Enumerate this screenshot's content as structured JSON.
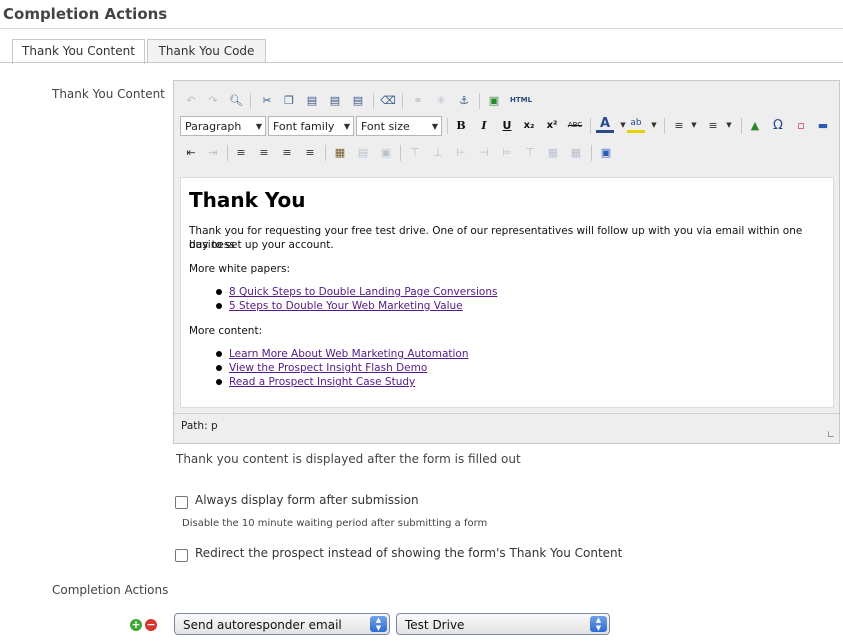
{
  "section_title": "Completion Actions",
  "tabs": [
    {
      "label": "Thank You Content",
      "active": true
    },
    {
      "label": "Thank You Code",
      "active": false
    }
  ],
  "thank_you_label": "Thank You Content",
  "editor": {
    "format_select": "Paragraph",
    "font_family_select": "Font family",
    "font_size_select": "Font size",
    "html_button": "HTML",
    "content": {
      "heading": "Thank You",
      "paragraph1_line1": "Thank you for requesting your free test drive. One of our representatives will follow up with you via email within one business",
      "paragraph1_line2": "day to set up your account.",
      "white_papers_label": "More white papers:",
      "white_papers": [
        "8 Quick Steps to Double Landing Page Conversions",
        "5 Steps to Double Your Web Marketing Value"
      ],
      "more_content_label": "More content:",
      "content_links": [
        "Learn More About Web Marketing Automation",
        "View the Prospect Insight Flash Demo",
        "Read a Prospect Insight Case Study"
      ]
    },
    "path": "Path: p"
  },
  "helper_text": "Thank you content is displayed after the form is filled out",
  "always_display": {
    "label": "Always display form after submission",
    "checked": false,
    "hint": "Disable the 10 minute waiting period after submitting a form"
  },
  "redirect": {
    "label": "Redirect the prospect instead of showing the form's Thank You Content",
    "checked": false
  },
  "completion_actions_label": "Completion Actions",
  "action_row": {
    "action": "Send autoresponder email",
    "value": "Test Drive"
  },
  "colors": {
    "accent_add": "#3fa535",
    "accent_remove": "#d9342b",
    "link": "#551a8b",
    "select_spin": "#2f6bd3"
  }
}
